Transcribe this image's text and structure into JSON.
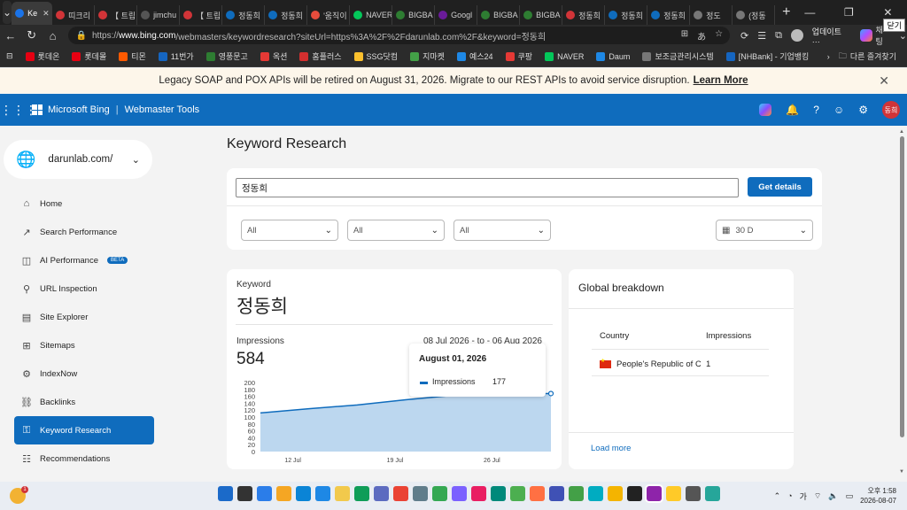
{
  "browser": {
    "tabs": [
      {
        "label": "Ke",
        "color": "#1a73e8",
        "active": true
      },
      {
        "label": "띠크리",
        "color": "#d13438"
      },
      {
        "label": "【 트립",
        "color": "#d13438"
      },
      {
        "label": "jimchu",
        "color": "#555555"
      },
      {
        "label": "【 트립",
        "color": "#d13438"
      },
      {
        "label": "정동희",
        "color": "#0f6cbd"
      },
      {
        "label": "정동희",
        "color": "#0f6cbd"
      },
      {
        "label": "'움직이",
        "color": "#e74c3c"
      },
      {
        "label": "NAVER",
        "color": "#03c75a"
      },
      {
        "label": "BIGBA",
        "color": "#2e7d32"
      },
      {
        "label": "Googl",
        "color": "#6a1b9a"
      },
      {
        "label": "BIGBA",
        "color": "#2e7d32"
      },
      {
        "label": "BIGBA",
        "color": "#2e7d32"
      },
      {
        "label": "정동희",
        "color": "#d13438"
      },
      {
        "label": "정동희",
        "color": "#0f6cbd"
      },
      {
        "label": "정동희",
        "color": "#0f6cbd"
      },
      {
        "label": "정도",
        "color": "#777777"
      },
      {
        "label": "(정동",
        "color": "#777777"
      }
    ],
    "close_tooltip": "닫기",
    "url_prefix": "https://",
    "url_domain": "www.bing.com",
    "url_rest": "/webmasters/keywordresearch?siteUrl=https%3A%2F%2Fdarunlab.com%2F&keyword=정동희",
    "update_label": "업데이트 ···",
    "copilot_label": "채팅",
    "bookmarks": [
      {
        "label": "롯데온",
        "color": "#e60012"
      },
      {
        "label": "롯데몰",
        "color": "#e60012"
      },
      {
        "label": "티몬",
        "color": "#ff5a00"
      },
      {
        "label": "11번가",
        "color": "#1565c0"
      },
      {
        "label": "영풍문고",
        "color": "#2e7d32"
      },
      {
        "label": "옥션",
        "color": "#e53935"
      },
      {
        "label": "홈플러스",
        "color": "#d32f2f"
      },
      {
        "label": "SSG닷컴",
        "color": "#fbc02d"
      },
      {
        "label": "지마켓",
        "color": "#43a047"
      },
      {
        "label": "예스24",
        "color": "#1e88e5"
      },
      {
        "label": "쿠팡",
        "color": "#e53935"
      },
      {
        "label": "NAVER",
        "color": "#03c75a"
      },
      {
        "label": "Daum",
        "color": "#1e88e5"
      },
      {
        "label": "보조금관리시스템",
        "color": "#777777"
      },
      {
        "label": "[NHBank] - 기업뱅킹",
        "color": "#1565c0"
      }
    ],
    "other_bookmarks": "다른 즐겨찾기"
  },
  "banner": {
    "message": "Legacy SOAP and POX APIs will be retired on August 31, 2026. Migrate to our REST APIs to avoid service disruption.",
    "link": "Learn More"
  },
  "app": {
    "brand": "Microsoft Bing",
    "product": "Webmaster Tools",
    "user_initials": "동희"
  },
  "sidebar": {
    "site": "darunlab.com/",
    "items": [
      {
        "label": "Home",
        "icon": "home-icon"
      },
      {
        "label": "Search Performance",
        "icon": "trend-icon"
      },
      {
        "label": "AI Performance",
        "icon": "ai-icon",
        "badge": "BETA"
      },
      {
        "label": "URL Inspection",
        "icon": "search-icon"
      },
      {
        "label": "Site Explorer",
        "icon": "document-icon"
      },
      {
        "label": "Sitemaps",
        "icon": "sitemap-icon"
      },
      {
        "label": "IndexNow",
        "icon": "gear-icon"
      },
      {
        "label": "Backlinks",
        "icon": "link-icon"
      },
      {
        "label": "Keyword Research",
        "icon": "key-icon",
        "active": true
      },
      {
        "label": "Recommendations",
        "icon": "checklist-icon"
      }
    ]
  },
  "main": {
    "title": "Keyword Research",
    "keyword_input": "정동희",
    "get_details": "Get details",
    "filters": [
      "All",
      "All",
      "All"
    ],
    "period": "30 D"
  },
  "keyword_card": {
    "label": "Keyword",
    "keyword": "정동희",
    "impressions_label": "Impressions",
    "impressions": "584",
    "date_range": "08 Jul 2026 - to - 06 Aug 2026"
  },
  "tooltip": {
    "date": "August 01, 2026",
    "series": "Impressions",
    "value": "177"
  },
  "global_breakdown": {
    "title": "Global breakdown",
    "col_country": "Country",
    "col_impressions": "Impressions",
    "rows": [
      {
        "country": "People's Republic of China",
        "impressions": "1"
      }
    ],
    "load_more": "Load more"
  },
  "chart_data": {
    "type": "area",
    "series": [
      {
        "name": "Impressions",
        "values": [
          112,
          124,
          135,
          150,
          163,
          168,
          168
        ]
      }
    ],
    "x": [
      "08 Jul",
      "12 Jul",
      "16 Jul",
      "19 Jul",
      "23 Jul",
      "26 Jul",
      "01 Aug"
    ],
    "x_ticks": [
      "12 Jul",
      "19 Jul",
      "26 Jul"
    ],
    "y_ticks": [
      0,
      20,
      40,
      60,
      80,
      100,
      120,
      140,
      160,
      180,
      200
    ],
    "ylim": [
      0,
      200
    ],
    "color": "#0f6cbd"
  },
  "taskbar": {
    "time": "오후 1:58",
    "date": "2026-08-07",
    "ime": "가",
    "notifications": "1"
  }
}
